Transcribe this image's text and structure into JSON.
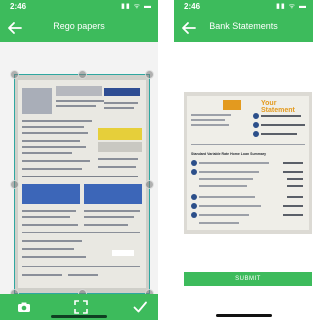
{
  "left_screen": {
    "status_bar": {
      "time": "2:46",
      "icons": "▮▮ ᯤ ▬"
    },
    "app_bar": {
      "title": "Rego papers",
      "back_icon": "arrow-left-icon"
    },
    "document": {
      "description_icon": "document-photo"
    },
    "bottom_bar": {
      "camera_icon": "camera-icon",
      "crop_icon": "crop-frame-icon",
      "confirm_icon": "checkmark-icon"
    }
  },
  "right_screen": {
    "status_bar": {
      "time": "2:46",
      "icons": "▮▮ ᯤ ▬"
    },
    "app_bar": {
      "title": "Bank Statements",
      "back_icon": "arrow-left-icon"
    },
    "document": {
      "heading": "Your Statement",
      "section_title": "Standard Variable Rate Home Loan Summary"
    },
    "submit_label": "SUBMIT"
  },
  "colors": {
    "accent": "#3dbb5c",
    "crop_outline": "#2fa7a0"
  }
}
